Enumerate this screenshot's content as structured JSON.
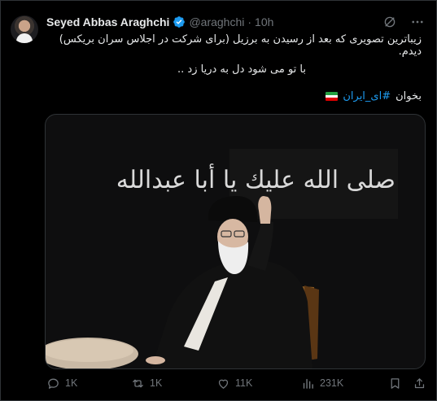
{
  "tweet": {
    "author_name": "Seyed Abbas Araghchi",
    "handle": "@araghchi",
    "separator": "·",
    "time": "10h",
    "text_line1": "زیباترین تصویری که بعد از رسیدن به برزیل (برای شرکت در اجلاس سران بریکس) دیدم.",
    "text_line2": "با تو می شود دل به دریا زد ..",
    "text_line3_word": "بخوان",
    "hashtag": "#ای_ایران",
    "image_calligraphy": "صلى الله عليك يا أبا عبدالله"
  },
  "metrics": {
    "replies": "1K",
    "reposts": "1K",
    "likes": "11K",
    "views": "231K"
  },
  "icons": {
    "verified": "verified-badge-icon",
    "grok": "grok-icon",
    "more": "more-icon",
    "reply": "reply-icon",
    "repost": "repost-icon",
    "like": "like-icon",
    "views": "views-icon",
    "bookmark": "bookmark-icon",
    "share": "share-icon"
  },
  "colors": {
    "background": "#000000",
    "text": "#e7e9ea",
    "muted": "#71767b",
    "accent": "#1d9bf0"
  }
}
